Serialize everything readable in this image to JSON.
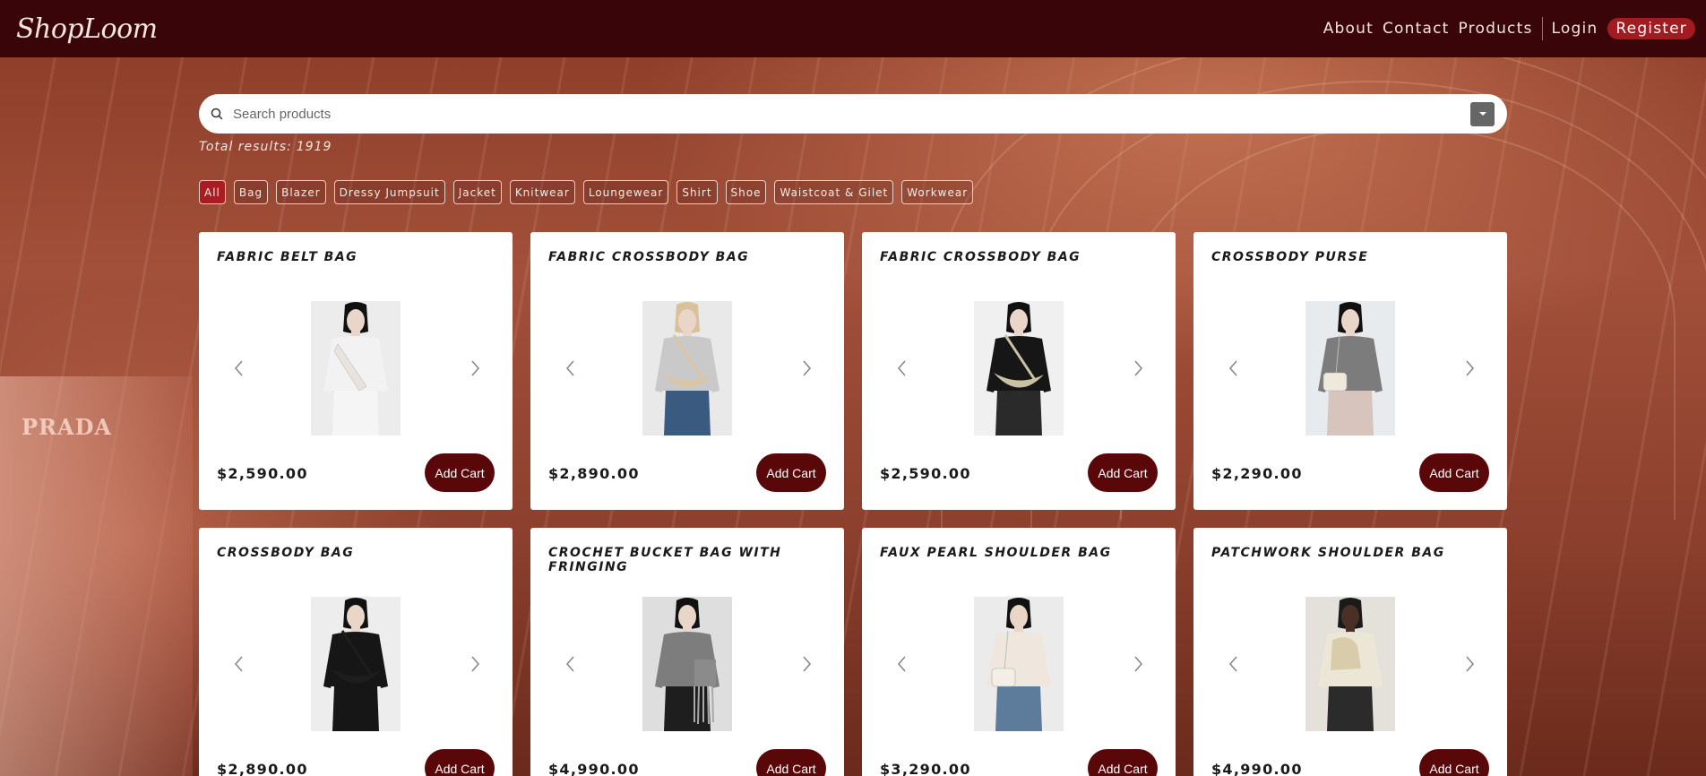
{
  "brand": {
    "logo": "ShopLoom"
  },
  "nav": {
    "about": "About",
    "contact": "Contact",
    "products": "Products",
    "login": "Login",
    "register": "Register"
  },
  "background": {
    "store_sign": "PRADA"
  },
  "search": {
    "placeholder": "Search products",
    "value": ""
  },
  "results": {
    "label": "Total results:",
    "count": "1919"
  },
  "categories": [
    "All",
    "Bag",
    "Blazer",
    "Dressy Jumpsuit",
    "Jacket",
    "Knitwear",
    "Loungewear",
    "Shirt",
    "Shoe",
    "Waistcoat & Gilet",
    "Workwear"
  ],
  "active_category": "All",
  "add_cart_label": "Add Cart",
  "products": [
    {
      "title": "FABRIC BELT BAG",
      "price": "$2,590.00",
      "top": "#f2f2f2",
      "bottom": "#f5f5f5",
      "bag": "#e8e4dd",
      "bag_shape": "belt",
      "hair": "#111",
      "bg": "#ececec"
    },
    {
      "title": "FABRIC CROSSBODY BAG",
      "price": "$2,890.00",
      "top": "#c9c9c9",
      "bottom": "#3a5a80",
      "bag": "#d9c6a6",
      "bag_shape": "crescent",
      "hair": "#d9c29a",
      "bg": "#e9e9e9"
    },
    {
      "title": "FABRIC CROSSBODY BAG",
      "price": "$2,590.00",
      "top": "#161616",
      "bottom": "#2a2a2a",
      "bag": "#c9c1a4",
      "bag_shape": "crescent",
      "hair": "#111",
      "bg": "#f0f0f0"
    },
    {
      "title": "CROSSBODY PURSE",
      "price": "$2,290.00",
      "top": "#7c7c7c",
      "bottom": "#d7c4bc",
      "bag": "#efe9dd",
      "bag_shape": "purse",
      "hair": "#111",
      "bg": "#e8ebee"
    },
    {
      "title": "CROSSBODY BAG",
      "price": "$2,890.00",
      "top": "#161616",
      "bottom": "#161616",
      "bag": "#1d1d1d",
      "bag_shape": "crescent",
      "hair": "#111",
      "bg": "#ededed"
    },
    {
      "title": "CROCHET BUCKET BAG WITH FRINGING",
      "price": "$4,990.00",
      "top": "#7d7d7d",
      "bottom": "#1e1e1e",
      "bag": "#8b8b8b",
      "bag_shape": "fringe",
      "hair": "#111",
      "bg": "#dedede"
    },
    {
      "title": "FAUX PEARL SHOULDER BAG",
      "price": "$3,290.00",
      "top": "#efe7dd",
      "bottom": "#5d7c9c",
      "bag": "#f3efe6",
      "bag_shape": "purse",
      "hair": "#111",
      "bg": "#ebebeb"
    },
    {
      "title": "PATCHWORK SHOULDER BAG",
      "price": "$4,990.00",
      "top": "#ece6d6",
      "bottom": "#2b2b2b",
      "bag": "#d8ccaa",
      "bag_shape": "shoulder",
      "hair": "#1a1a1a",
      "bg": "#e3e1da",
      "skin": "#4a3024"
    }
  ]
}
